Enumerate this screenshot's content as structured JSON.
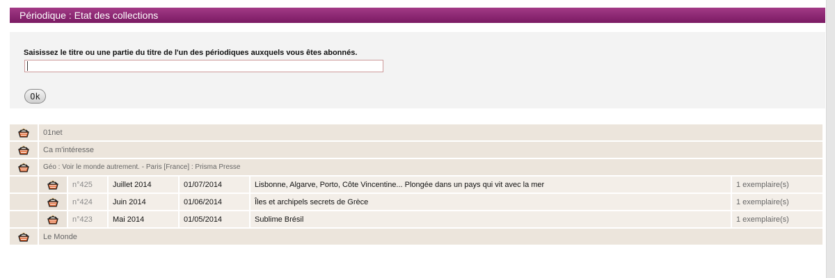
{
  "header": {
    "title": "Périodique : Etat des collections"
  },
  "search": {
    "label": "Saisissez le titre ou une partie du titre de l'un des périodiques auxquels vous êtes abonnés.",
    "value": "",
    "ok_label": "Ok"
  },
  "periodicals": [
    {
      "title": "01net",
      "icon": "basket-icon"
    },
    {
      "title": "Ca m'intéresse",
      "icon": "basket-icon"
    },
    {
      "title": "Géo : Voir le monde autrement. - Paris [France] : Prisma Presse",
      "icon": "basket-icon"
    },
    {
      "title": "Le Monde",
      "icon": "basket-icon"
    }
  ],
  "issues": [
    {
      "number": "n°425",
      "issue_label": "Juillet 2014",
      "date": "01/07/2014",
      "summary": "Lisbonne, Algarve, Porto, Côte Vincentine... Plongée dans un pays qui vit avec la mer",
      "copies": "1 exemplaire(s)"
    },
    {
      "number": "n°424",
      "issue_label": "Juin 2014",
      "date": "01/06/2014",
      "summary": "Îles et archipels secrets de Grèce",
      "copies": "1 exemplaire(s)"
    },
    {
      "number": "n°423",
      "issue_label": "Mai 2014",
      "date": "01/05/2014",
      "summary": "Sublime Brésil",
      "copies": "1 exemplaire(s)"
    }
  ],
  "colors": {
    "accent": "#8b2472",
    "row_bg": "#ece5dc",
    "sub_row_bg": "#f3eee8"
  }
}
